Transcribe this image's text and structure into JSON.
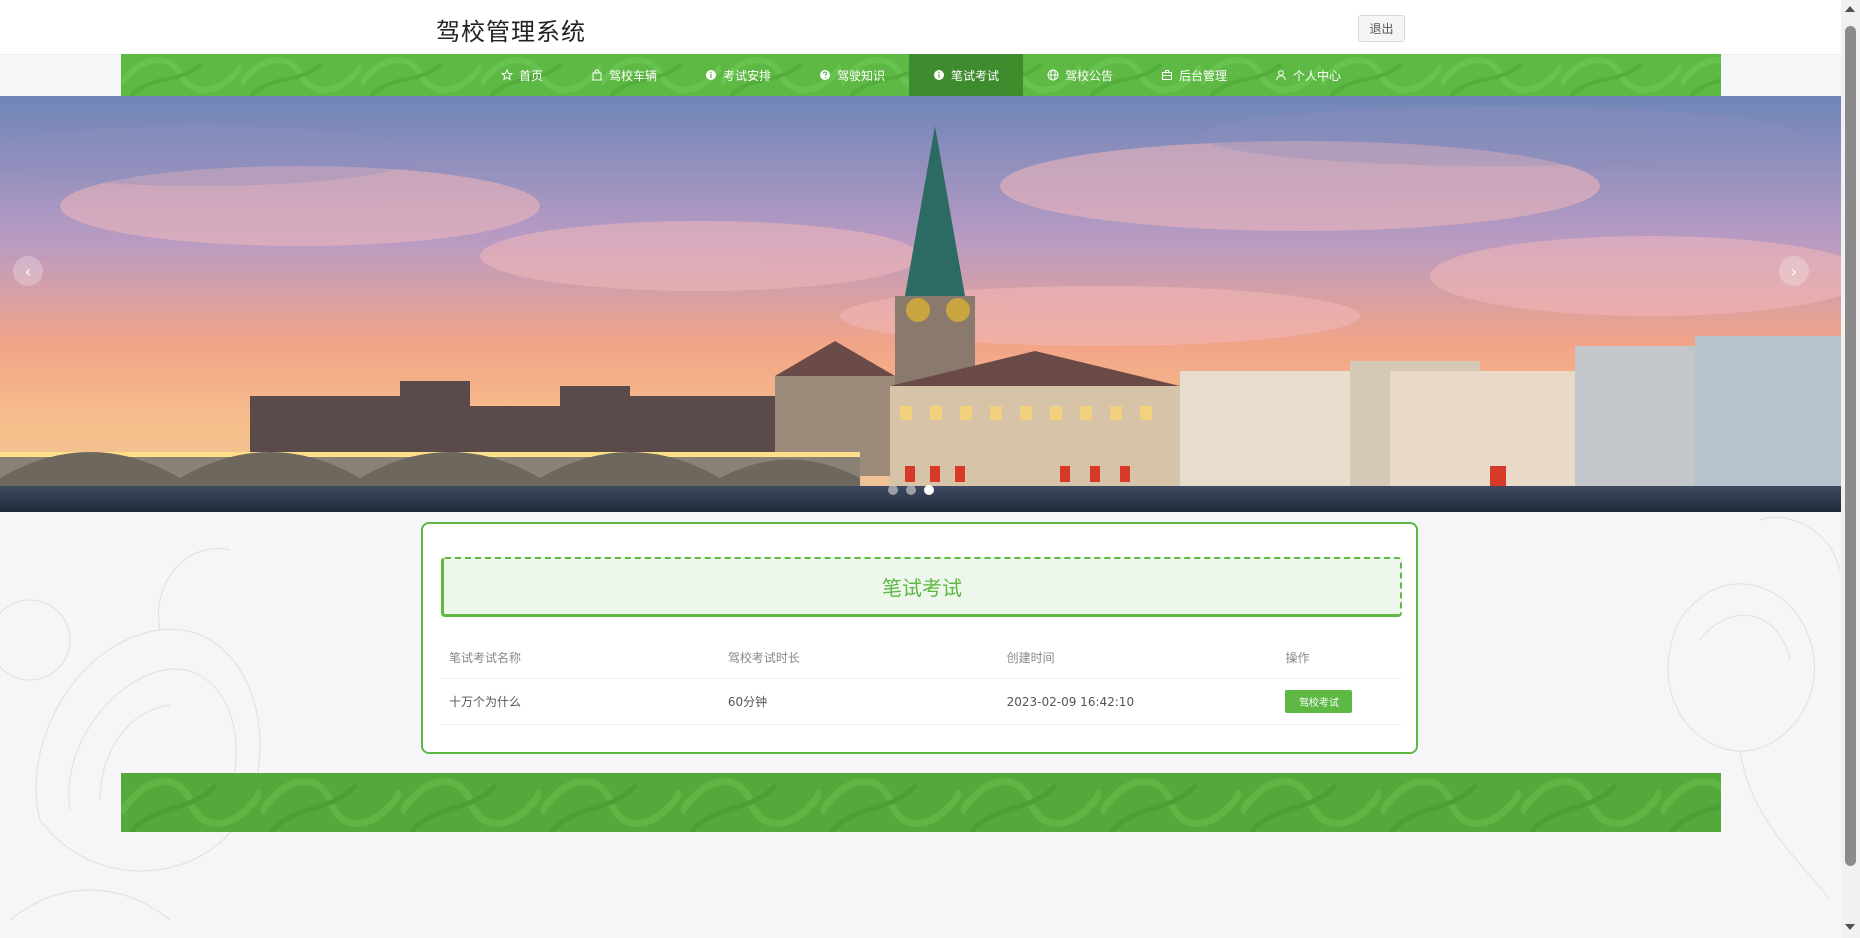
{
  "header": {
    "title": "驾校管理系统",
    "logout_label": "退出"
  },
  "nav": {
    "items": [
      {
        "label": "首页",
        "icon": "star-icon"
      },
      {
        "label": "驾校车辆",
        "icon": "bag-icon"
      },
      {
        "label": "考试安排",
        "icon": "info-icon"
      },
      {
        "label": "驾驶知识",
        "icon": "question-icon"
      },
      {
        "label": "笔试考试",
        "icon": "info-icon"
      },
      {
        "label": "驾校公告",
        "icon": "globe-icon"
      },
      {
        "label": "后台管理",
        "icon": "briefcase-icon"
      },
      {
        "label": "个人中心",
        "icon": "user-icon"
      }
    ],
    "active_index": 4
  },
  "banner": {
    "prev_label": "‹",
    "next_label": "›",
    "slide_count": 3,
    "active_slide": 2
  },
  "section": {
    "title": "笔试考试",
    "columns": [
      "笔试考试名称",
      "驾校考试时长",
      "创建时间",
      "操作"
    ],
    "rows": [
      {
        "name": "十万个为什么",
        "duration": "60分钟",
        "created": "2023-02-09 16:42:10",
        "action": "驾校考试"
      }
    ]
  },
  "colors": {
    "accent": "#5db844",
    "accent_dark": "#3f8c2f",
    "footer": "#55a93a"
  }
}
